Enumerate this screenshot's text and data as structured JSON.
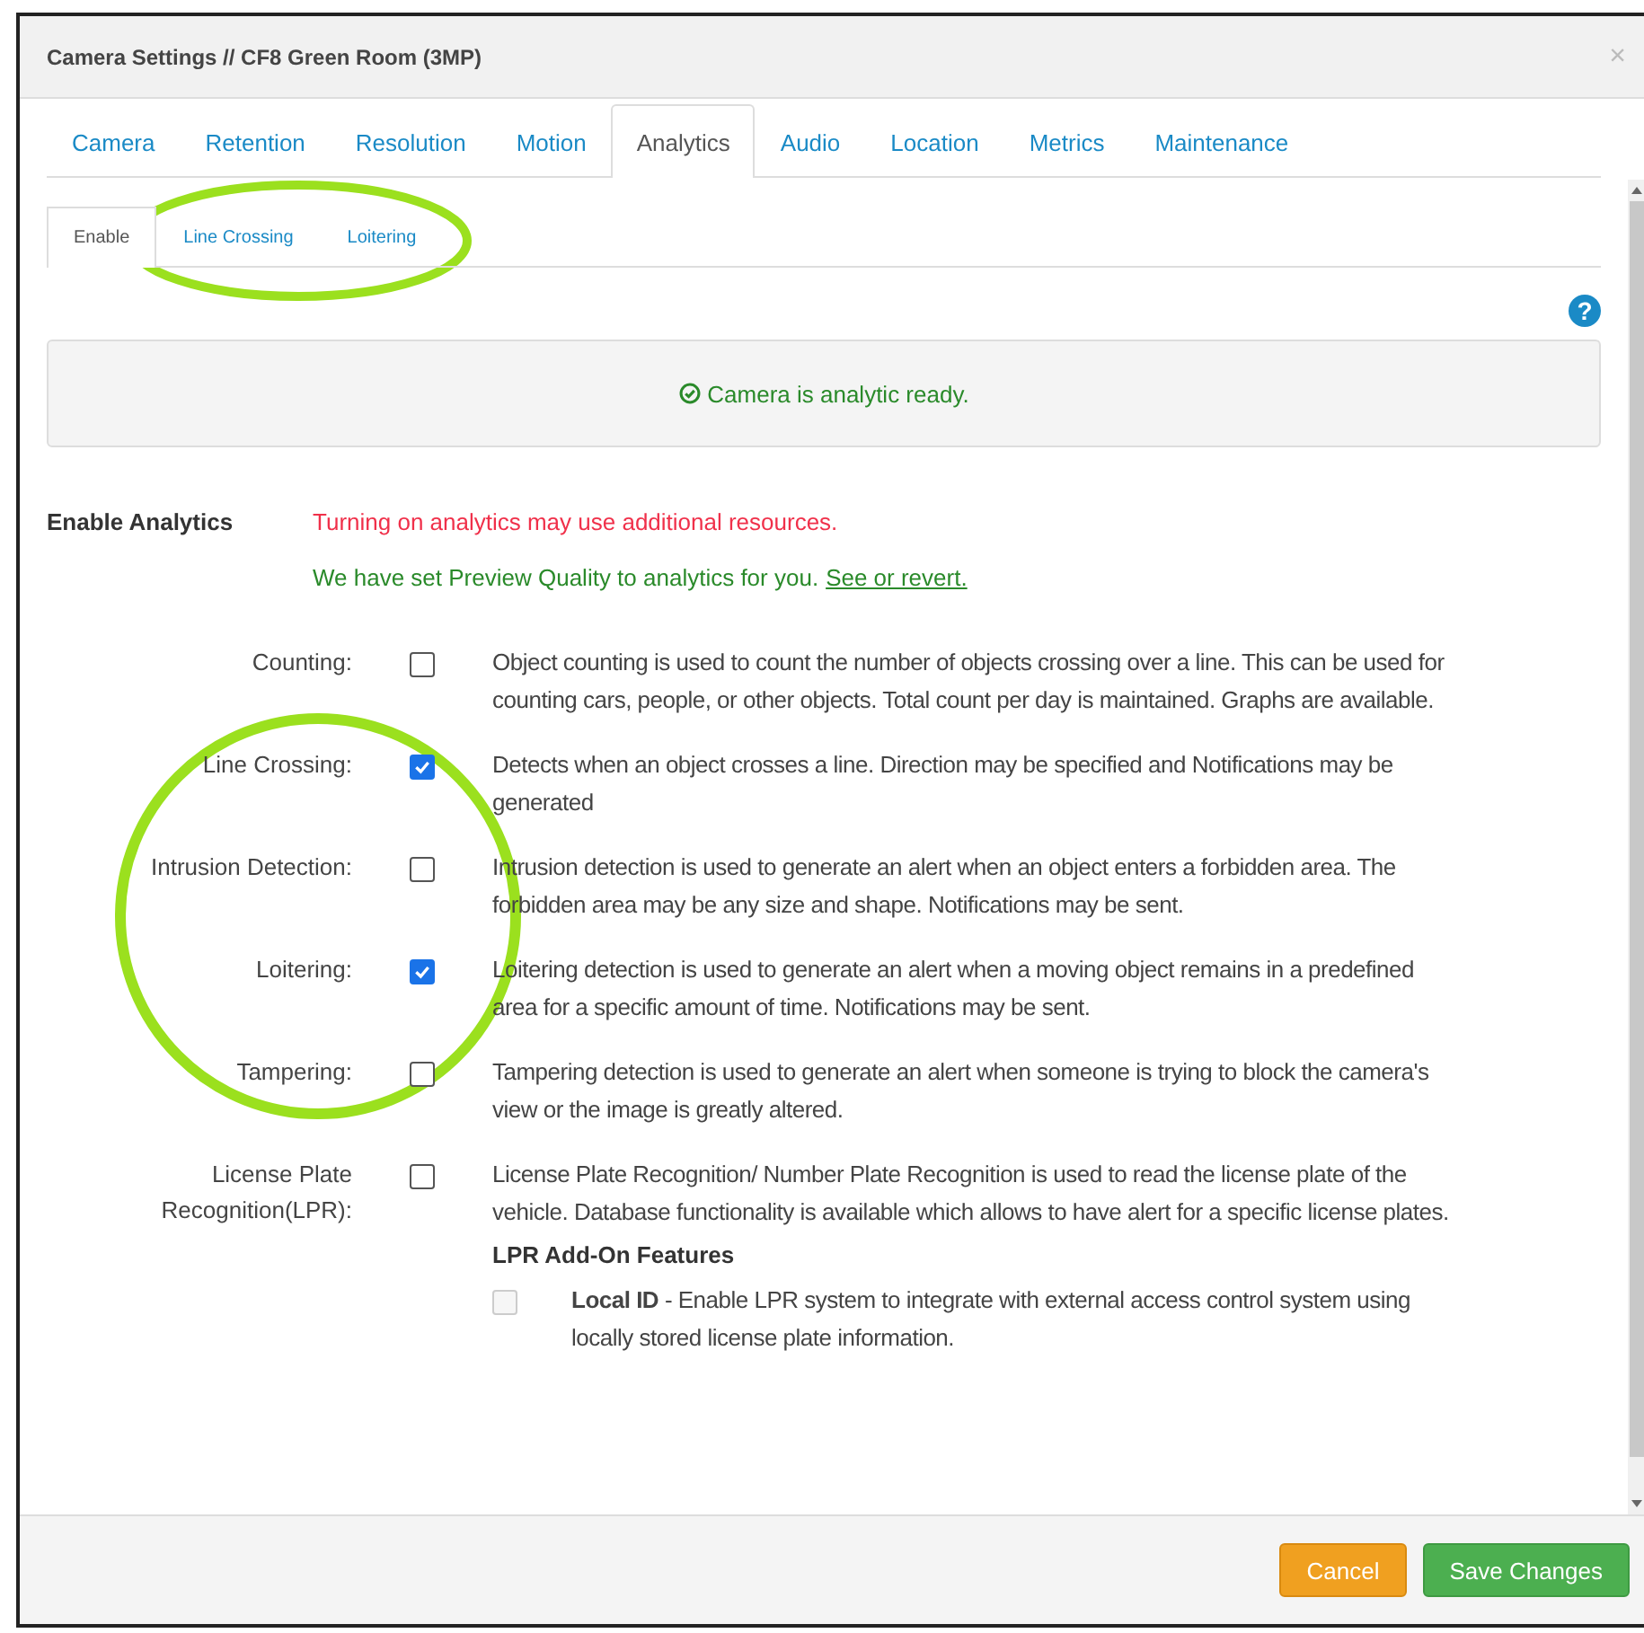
{
  "window": {
    "title": "Camera Settings // CF8 Green Room (3MP)",
    "close": "×"
  },
  "tabs": [
    {
      "label": "Camera",
      "selected": false
    },
    {
      "label": "Retention",
      "selected": false
    },
    {
      "label": "Resolution",
      "selected": false
    },
    {
      "label": "Motion",
      "selected": false
    },
    {
      "label": "Analytics",
      "selected": true
    },
    {
      "label": "Audio",
      "selected": false
    },
    {
      "label": "Location",
      "selected": false
    },
    {
      "label": "Metrics",
      "selected": false
    },
    {
      "label": "Maintenance",
      "selected": false
    }
  ],
  "subtabs": [
    {
      "label": "Enable",
      "selected": true
    },
    {
      "label": "Line Crossing",
      "selected": false
    },
    {
      "label": "Loitering",
      "selected": false
    }
  ],
  "help": "?",
  "alert": {
    "text": "Camera is analytic ready."
  },
  "enable": {
    "label": "Enable Analytics",
    "warning": "Turning on analytics may use additional resources.",
    "notice": "We have set Preview Quality to analytics for you.",
    "link": "See or revert."
  },
  "features": [
    {
      "label": "Counting:",
      "checked": false,
      "description": "Object counting is used to count the number of objects crossing over a line. This can be used for counting cars, people, or other objects. Total count per day is maintained. Graphs are available."
    },
    {
      "label": "Line Crossing:",
      "checked": true,
      "description": "Detects when an object crosses a line. Direction may be specified and Notifications may be generated"
    },
    {
      "label": "Intrusion Detection:",
      "checked": false,
      "description": "Intrusion detection is used to generate an alert when an object enters a forbidden area. The forbidden area may be any size and shape. Notifications may be sent."
    },
    {
      "label": "Loitering:",
      "checked": true,
      "description": "Loitering detection is used to generate an alert when a moving object remains in a predefined area for a specific amount of time. Notifications may be sent."
    },
    {
      "label": "Tampering:",
      "checked": false,
      "description": "Tampering detection is used to generate an alert when someone is trying to block the camera's view or the image is greatly altered."
    },
    {
      "label": "License Plate Recognition(LPR):",
      "checked": false,
      "description": "License Plate Recognition/ Number Plate Recognition is used to read the license plate of the vehicle. Database functionality is available which allows to have alert for a specific license plates."
    }
  ],
  "addon": {
    "heading": "LPR Add-On Features",
    "items": [
      {
        "text": "**Local ID** - Enable LPR system to integrate with external access control system using locally stored license plate information.",
        "disabled": true
      }
    ]
  },
  "buttons": [
    {
      "label": "Cancel",
      "kind": "cancel"
    },
    {
      "label": "Save Changes",
      "kind": "save"
    }
  ]
}
